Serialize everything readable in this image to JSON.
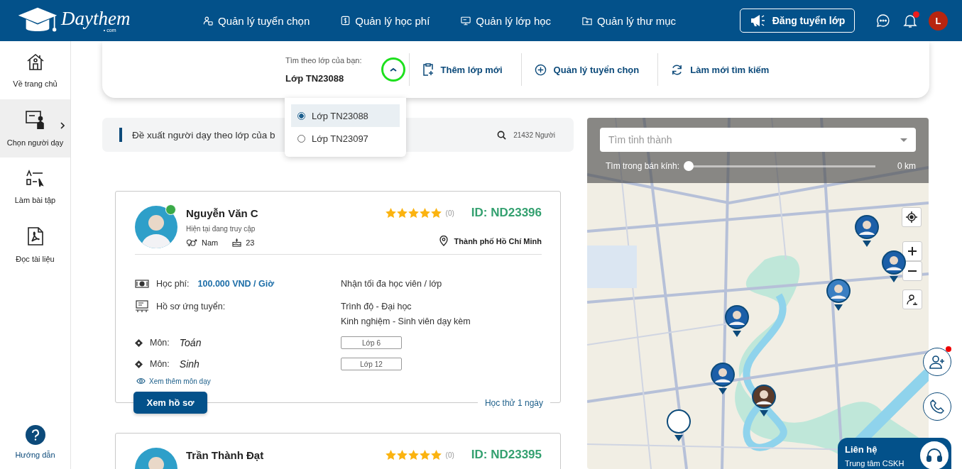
{
  "header": {
    "logo": {
      "name": "Daythem",
      "suffix": "• com"
    },
    "nav": [
      {
        "label": "Quản lý tuyển chọn",
        "kind": "people"
      },
      {
        "label": "Quản lý học phí",
        "kind": "money"
      },
      {
        "label": "Quản lý lớp học",
        "kind": "board"
      },
      {
        "label": "Quản lý thư mục",
        "kind": "folder"
      }
    ],
    "post_button": "Đăng tuyển lớp",
    "has_unread": true,
    "avatar_initial": "L"
  },
  "sidebar": {
    "items": [
      {
        "label": "Về trang chủ",
        "kind": "home",
        "selected": false
      },
      {
        "label": "Chọn người dạy",
        "kind": "teacher",
        "selected": true
      },
      {
        "label": "Làm bài tập",
        "kind": "quiz",
        "selected": false
      },
      {
        "label": "Đọc tài liệu",
        "kind": "pdf",
        "selected": false
      }
    ],
    "help": "Hướng dẫn"
  },
  "toolbar": {
    "filter_label": "Tìm theo lớp của bạn:",
    "filter_value": "Lớp TN23088",
    "expanded": true,
    "highlighted": true,
    "actions": [
      {
        "label": "Thêm lớp mới",
        "kind": "clipboard"
      },
      {
        "label": "Quản lý tuyển chọn",
        "kind": "plus"
      },
      {
        "label": "Làm mới tìm kiếm",
        "kind": "refresh"
      }
    ]
  },
  "dropdown": {
    "options": [
      {
        "label": "Lớp TN23088",
        "selected": true
      },
      {
        "label": "Lớp TN23097",
        "selected": false
      }
    ]
  },
  "banner": {
    "text": "Đề xuất người dạy theo lớp của b",
    "count": "21432 Người"
  },
  "tutors": [
    {
      "name": "Nguyễn Văn C",
      "online": true,
      "status": "Hiện tại đang truy cập",
      "gender": "Nam",
      "age": "23",
      "stars": 5,
      "reviews": "(0)",
      "id": "ID: ND23396",
      "location": "Thành phố Hồ Chí Minh",
      "fee_label": "Học phí:",
      "fee": "100.000 VND / Giờ",
      "capacity": "Nhận tối đa học viên / lớp",
      "profile_label": "Hồ sơ ứng tuyển:",
      "qualifications": [
        "Trình độ - Đại học",
        "Kinh nghiệm - Sinh viên dạy kèm"
      ],
      "subjects": [
        {
          "label": "Môn:",
          "name": "Toán",
          "grade": "Lớp 6"
        },
        {
          "label": "Môn:",
          "name": "Sinh",
          "grade": "Lớp 12"
        }
      ],
      "more_link": "Xem thêm môn dạy",
      "view_button": "Xem hồ sơ",
      "trial": "Học thử 1 ngày"
    },
    {
      "name": "Trần Thành Đạt",
      "online": false,
      "stars": 5,
      "reviews": "(0)",
      "id": "ID: ND23395"
    }
  ],
  "map": {
    "search_placeholder": "Tìm tỉnh thành",
    "radius_label": "Tìm trong bán kính:",
    "radius": {
      "level": 0
    },
    "radius_value": "0 km"
  },
  "contact": {
    "title": "Liên hệ",
    "subtitle": "Trung tâm CSKH",
    "invite_unread": true
  }
}
